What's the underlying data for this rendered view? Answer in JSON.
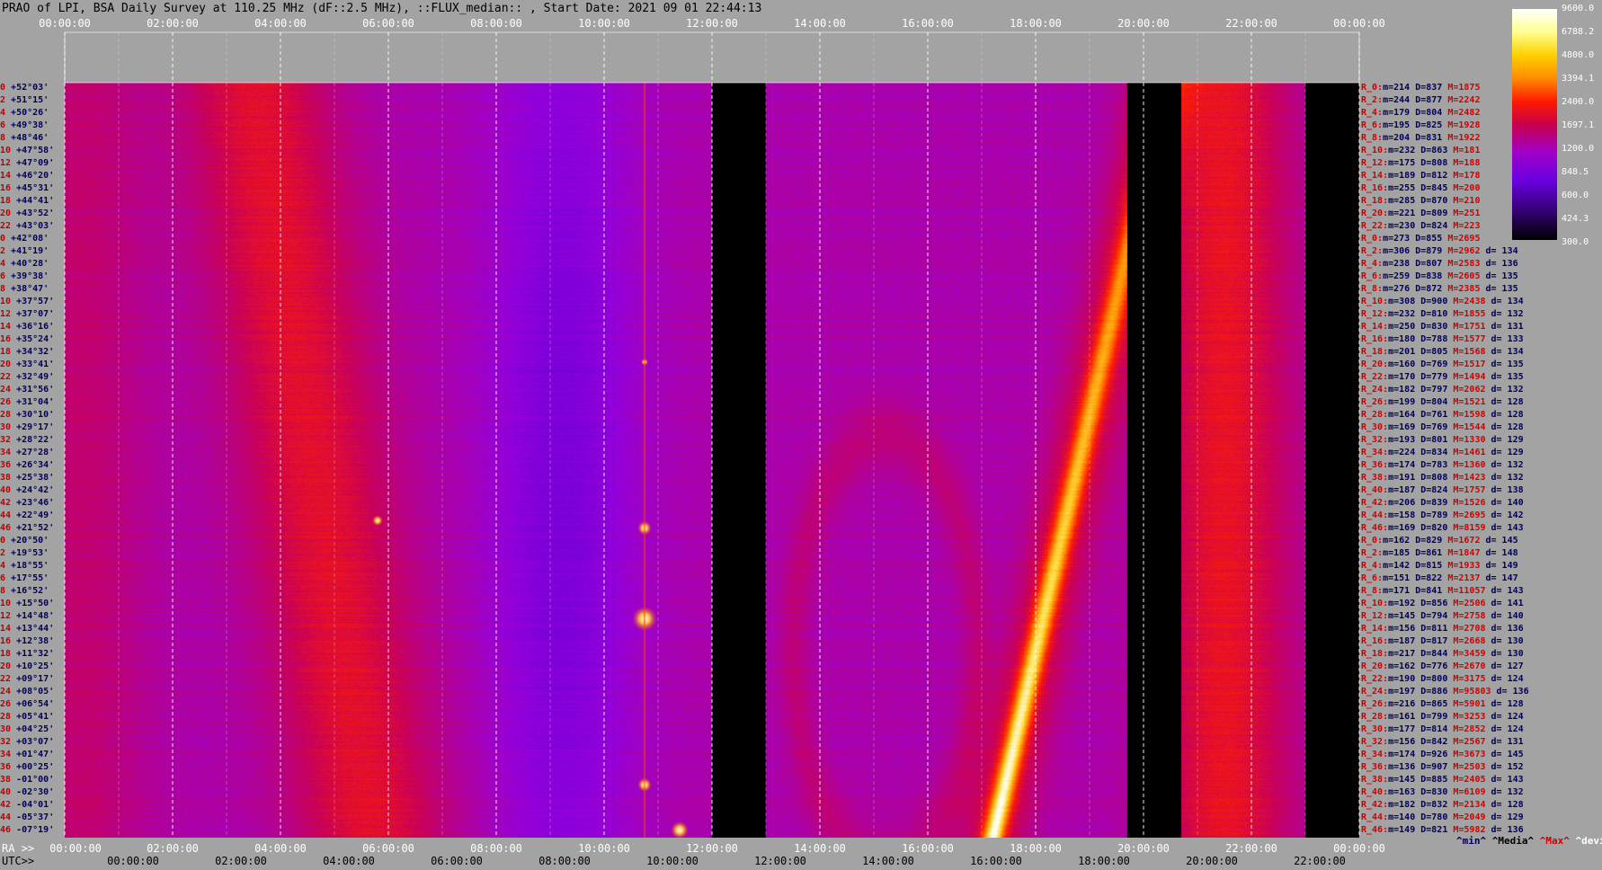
{
  "title": "PRAO of LPI, BSA Daily Survey at 110.25 MHz (dF::2.5 MHz), ::FLUX_median:: , Start Date: 2021 09 01 22:44:13",
  "top_ticks": [
    "00:00:00",
    "02:00:00",
    "04:00:00",
    "06:00:00",
    "08:00:00",
    "10:00:00",
    "12:00:00",
    "14:00:00",
    "16:00:00",
    "18:00:00",
    "20:00:00",
    "22:00:00",
    "00:00:00"
  ],
  "bottom_axis": {
    "ra_prefix": "RA >>",
    "utc_prefix": "UTC>>",
    "ra_ticks": [
      "00:00:00",
      "02:00:00",
      "04:00:00",
      "06:00:00",
      "08:00:00",
      "10:00:00",
      "12:00:00",
      "14:00:00",
      "16:00:00",
      "18:00:00",
      "20:00:00",
      "22:00:00",
      "00:00:00"
    ],
    "utc_ticks": [
      "00:00:00",
      "02:00:00",
      "04:00:00",
      "06:00:00",
      "08:00:00",
      "10:00:00",
      "12:00:00",
      "14:00:00",
      "16:00:00",
      "18:00:00",
      "20:00:00",
      "22:00:00"
    ]
  },
  "colorbar": {
    "labels": [
      "9600.0",
      "6788.2",
      "4800.0",
      "3394.1",
      "2400.0",
      "1697.1",
      "1200.0",
      "848.5",
      "600.0",
      "424.3",
      "300.0"
    ]
  },
  "footer": {
    "min": "^min^",
    "median": "^Media^",
    "max": "^Max^",
    "dev": "^devia^"
  },
  "colors": {
    "min": "#000060",
    "median": "#000000",
    "max": "#d40000",
    "dev": "#ffffff"
  },
  "chart_data": {
    "type": "heatmap",
    "title": "PRAO of LPI, BSA Daily Survey at 110.25 MHz (dF::2.5 MHz), ::FLUX_median:: , Start Date: 2021 09 01 22:44:13",
    "x_axis": "RA / UTC, 00:00:00 to 00:00:00",
    "colorscale_range": [
      300.0,
      9600.0
    ],
    "blanked_utc_intervals": [
      [
        "12:00",
        "13:00"
      ],
      [
        "19:40",
        "20:40"
      ],
      [
        "23:00",
        "24:00"
      ]
    ],
    "rows": [
      {
        "idx": "0",
        "dec": "+52°03'"
      },
      {
        "idx": "2",
        "dec": "+51°15'"
      },
      {
        "idx": "4",
        "dec": "+50°26'"
      },
      {
        "idx": "6",
        "dec": "+49°38'"
      },
      {
        "idx": "8",
        "dec": "+48°46'"
      },
      {
        "idx": "10",
        "dec": "+47°58'"
      },
      {
        "idx": "12",
        "dec": "+47°09'"
      },
      {
        "idx": "14",
        "dec": "+46°20'"
      },
      {
        "idx": "16",
        "dec": "+45°31'"
      },
      {
        "idx": "18",
        "dec": "+44°41'"
      },
      {
        "idx": "20",
        "dec": "+43°52'"
      },
      {
        "idx": "22",
        "dec": "+43°03'"
      },
      {
        "idx": "0",
        "dec": "+42°08'"
      },
      {
        "idx": "2",
        "dec": "+41°19'"
      },
      {
        "idx": "4",
        "dec": "+40°28'"
      },
      {
        "idx": "6",
        "dec": "+39°38'"
      },
      {
        "idx": "8",
        "dec": "+38°47'"
      },
      {
        "idx": "10",
        "dec": "+37°57'"
      },
      {
        "idx": "12",
        "dec": "+37°07'"
      },
      {
        "idx": "14",
        "dec": "+36°16'"
      },
      {
        "idx": "16",
        "dec": "+35°24'"
      },
      {
        "idx": "18",
        "dec": "+34°32'"
      },
      {
        "idx": "20",
        "dec": "+33°41'"
      },
      {
        "idx": "22",
        "dec": "+32°49'"
      },
      {
        "idx": "24",
        "dec": "+31°56'"
      },
      {
        "idx": "26",
        "dec": "+31°04'"
      },
      {
        "idx": "28",
        "dec": "+30°10'"
      },
      {
        "idx": "30",
        "dec": "+29°17'"
      },
      {
        "idx": "32",
        "dec": "+28°22'"
      },
      {
        "idx": "34",
        "dec": "+27°28'"
      },
      {
        "idx": "36",
        "dec": "+26°34'"
      },
      {
        "idx": "38",
        "dec": "+25°38'"
      },
      {
        "idx": "40",
        "dec": "+24°42'"
      },
      {
        "idx": "42",
        "dec": "+23°46'"
      },
      {
        "idx": "44",
        "dec": "+22°49'"
      },
      {
        "idx": "46",
        "dec": "+21°52'"
      },
      {
        "idx": "0",
        "dec": "+20°50'"
      },
      {
        "idx": "2",
        "dec": "+19°53'"
      },
      {
        "idx": "4",
        "dec": "+18°55'"
      },
      {
        "idx": "6",
        "dec": "+17°55'"
      },
      {
        "idx": "8",
        "dec": "+16°52'"
      },
      {
        "idx": "10",
        "dec": "+15°50'"
      },
      {
        "idx": "12",
        "dec": "+14°48'"
      },
      {
        "idx": "14",
        "dec": "+13°44'"
      },
      {
        "idx": "16",
        "dec": "+12°38'"
      },
      {
        "idx": "18",
        "dec": "+11°32'"
      },
      {
        "idx": "20",
        "dec": "+10°25'"
      },
      {
        "idx": "22",
        "dec": "+09°17'"
      },
      {
        "idx": "24",
        "dec": "+08°05'"
      },
      {
        "idx": "26",
        "dec": "+06°54'"
      },
      {
        "idx": "28",
        "dec": "+05°41'"
      },
      {
        "idx": "30",
        "dec": "+04°25'"
      },
      {
        "idx": "32",
        "dec": "+03°07'"
      },
      {
        "idx": "34",
        "dec": "+01°47'"
      },
      {
        "idx": "36",
        "dec": "+00°25'"
      },
      {
        "idx": "38",
        "dec": "-01°00'"
      },
      {
        "idx": "40",
        "dec": "-02°30'"
      },
      {
        "idx": "42",
        "dec": "-04°01'"
      },
      {
        "idx": "44",
        "dec": "-05°37'"
      },
      {
        "idx": "46",
        "dec": "-07°19'"
      }
    ],
    "stats": [
      {
        "r": "R_0:",
        "min": "m=214",
        "med": "D=837",
        "max": "M=1875",
        "dev": ""
      },
      {
        "r": "R_2:",
        "min": "m=244",
        "med": "D=877",
        "max": "M=2242",
        "dev": ""
      },
      {
        "r": "R_4:",
        "min": "m=179",
        "med": "D=804",
        "max": "M=2482",
        "dev": ""
      },
      {
        "r": "R_6:",
        "min": "m=195",
        "med": "D=825",
        "max": "M=1928",
        "dev": ""
      },
      {
        "r": "R_8:",
        "min": "m=204",
        "med": "D=831",
        "max": "M=1922",
        "dev": ""
      },
      {
        "r": "R_10:",
        "min": "m=232",
        "med": "D=863",
        "max": "M=181",
        "dev": ""
      },
      {
        "r": "R_12:",
        "min": "m=175",
        "med": "D=808",
        "max": "M=188",
        "dev": ""
      },
      {
        "r": "R_14:",
        "min": "m=189",
        "med": "D=812",
        "max": "M=178",
        "dev": ""
      },
      {
        "r": "R_16:",
        "min": "m=255",
        "med": "D=845",
        "max": "M=200",
        "dev": ""
      },
      {
        "r": "R_18:",
        "min": "m=285",
        "med": "D=870",
        "max": "M=210",
        "dev": ""
      },
      {
        "r": "R_20:",
        "min": "m=221",
        "med": "D=809",
        "max": "M=251",
        "dev": ""
      },
      {
        "r": "R_22:",
        "min": "m=230",
        "med": "D=824",
        "max": "M=223",
        "dev": ""
      },
      {
        "r": "R_0:",
        "min": "m=273",
        "med": "D=855",
        "max": "M=2695",
        "dev": ""
      },
      {
        "r": "R_2:",
        "min": "m=306",
        "med": "D=879",
        "max": "M=2962",
        "dev": "d= 134"
      },
      {
        "r": "R_4:",
        "min": "m=238",
        "med": "D=807",
        "max": "M=2583",
        "dev": "d= 136"
      },
      {
        "r": "R_6:",
        "min": "m=259",
        "med": "D=838",
        "max": "M=2605",
        "dev": "d= 135"
      },
      {
        "r": "R_8:",
        "min": "m=276",
        "med": "D=872",
        "max": "M=2385",
        "dev": "d= 135"
      },
      {
        "r": "R_10:",
        "min": "m=308",
        "med": "D=900",
        "max": "M=2438",
        "dev": "d= 134"
      },
      {
        "r": "R_12:",
        "min": "m=232",
        "med": "D=810",
        "max": "M=1855",
        "dev": "d= 132"
      },
      {
        "r": "R_14:",
        "min": "m=250",
        "med": "D=830",
        "max": "M=1751",
        "dev": "d= 131"
      },
      {
        "r": "R_16:",
        "min": "m=180",
        "med": "D=788",
        "max": "M=1577",
        "dev": "d= 133"
      },
      {
        "r": "R_18:",
        "min": "m=201",
        "med": "D=805",
        "max": "M=1568",
        "dev": "d= 134"
      },
      {
        "r": "R_20:",
        "min": "m=160",
        "med": "D=769",
        "max": "M=1517",
        "dev": "d= 135"
      },
      {
        "r": "R_22:",
        "min": "m=170",
        "med": "D=779",
        "max": "M=1494",
        "dev": "d= 135"
      },
      {
        "r": "R_24:",
        "min": "m=182",
        "med": "D=797",
        "max": "M=2062",
        "dev": "d= 132"
      },
      {
        "r": "R_26:",
        "min": "m=199",
        "med": "D=804",
        "max": "M=1521",
        "dev": "d= 128"
      },
      {
        "r": "R_28:",
        "min": "m=164",
        "med": "D=761",
        "max": "M=1598",
        "dev": "d= 128"
      },
      {
        "r": "R_30:",
        "min": "m=169",
        "med": "D=769",
        "max": "M=1544",
        "dev": "d= 128"
      },
      {
        "r": "R_32:",
        "min": "m=193",
        "med": "D=801",
        "max": "M=1330",
        "dev": "d= 129"
      },
      {
        "r": "R_34:",
        "min": "m=224",
        "med": "D=834",
        "max": "M=1461",
        "dev": "d= 129"
      },
      {
        "r": "R_36:",
        "min": "m=174",
        "med": "D=783",
        "max": "M=1360",
        "dev": "d= 132"
      },
      {
        "r": "R_38:",
        "min": "m=191",
        "med": "D=808",
        "max": "M=1423",
        "dev": "d= 132"
      },
      {
        "r": "R_40:",
        "min": "m=187",
        "med": "D=824",
        "max": "M=1757",
        "dev": "d= 138"
      },
      {
        "r": "R_42:",
        "min": "m=206",
        "med": "D=839",
        "max": "M=1526",
        "dev": "d= 140"
      },
      {
        "r": "R_44:",
        "min": "m=158",
        "med": "D=789",
        "max": "M=2695",
        "dev": "d= 142"
      },
      {
        "r": "R_46:",
        "min": "m=169",
        "med": "D=820",
        "max": "M=8159",
        "dev": "d= 143"
      },
      {
        "r": "R_0:",
        "min": "m=162",
        "med": "D=829",
        "max": "M=1672",
        "dev": "d= 145"
      },
      {
        "r": "R_2:",
        "min": "m=185",
        "med": "D=861",
        "max": "M=1847",
        "dev": "d= 148"
      },
      {
        "r": "R_4:",
        "min": "m=142",
        "med": "D=815",
        "max": "M=1933",
        "dev": "d= 149"
      },
      {
        "r": "R_6:",
        "min": "m=151",
        "med": "D=822",
        "max": "M=2137",
        "dev": "d= 147"
      },
      {
        "r": "R_8:",
        "min": "m=171",
        "med": "D=841",
        "max": "M=11057",
        "dev": "d= 143"
      },
      {
        "r": "R_10:",
        "min": "m=192",
        "med": "D=856",
        "max": "M=2506",
        "dev": "d= 141"
      },
      {
        "r": "R_12:",
        "min": "m=145",
        "med": "D=794",
        "max": "M=2758",
        "dev": "d= 140"
      },
      {
        "r": "R_14:",
        "min": "m=156",
        "med": "D=811",
        "max": "M=2708",
        "dev": "d= 136"
      },
      {
        "r": "R_16:",
        "min": "m=187",
        "med": "D=817",
        "max": "M=2668",
        "dev": "d= 130"
      },
      {
        "r": "R_18:",
        "min": "m=217",
        "med": "D=844",
        "max": "M=3459",
        "dev": "d= 130"
      },
      {
        "r": "R_20:",
        "min": "m=162",
        "med": "D=776",
        "max": "M=2670",
        "dev": "d= 127"
      },
      {
        "r": "R_22:",
        "min": "m=190",
        "med": "D=800",
        "max": "M=3175",
        "dev": "d= 124"
      },
      {
        "r": "R_24:",
        "min": "m=197",
        "med": "D=886",
        "max": "M=95803",
        "dev": "d= 136"
      },
      {
        "r": "R_26:",
        "min": "m=216",
        "med": "D=865",
        "max": "M=5901",
        "dev": "d= 128"
      },
      {
        "r": "R_28:",
        "min": "m=161",
        "med": "D=799",
        "max": "M=3253",
        "dev": "d= 124"
      },
      {
        "r": "R_30:",
        "min": "m=177",
        "med": "D=814",
        "max": "M=2852",
        "dev": "d= 124"
      },
      {
        "r": "R_32:",
        "min": "m=156",
        "med": "D=842",
        "max": "M=2567",
        "dev": "d= 131"
      },
      {
        "r": "R_34:",
        "min": "m=174",
        "med": "D=926",
        "max": "M=3673",
        "dev": "d= 145"
      },
      {
        "r": "R_36:",
        "min": "m=136",
        "med": "D=907",
        "max": "M=2503",
        "dev": "d= 152"
      },
      {
        "r": "R_38:",
        "min": "m=145",
        "med": "D=885",
        "max": "M=2405",
        "dev": "d= 143"
      },
      {
        "r": "R_40:",
        "min": "m=163",
        "med": "D=830",
        "max": "M=6109",
        "dev": "d= 132"
      },
      {
        "r": "R_42:",
        "min": "m=182",
        "med": "D=832",
        "max": "M=2134",
        "dev": "d= 128"
      },
      {
        "r": "R_44:",
        "min": "m=140",
        "med": "D=780",
        "max": "M=2049",
        "dev": "d= 129"
      },
      {
        "r": "R_46:",
        "min": "m=149",
        "med": "D=821",
        "max": "M=5982",
        "dev": "d= 136"
      }
    ]
  }
}
